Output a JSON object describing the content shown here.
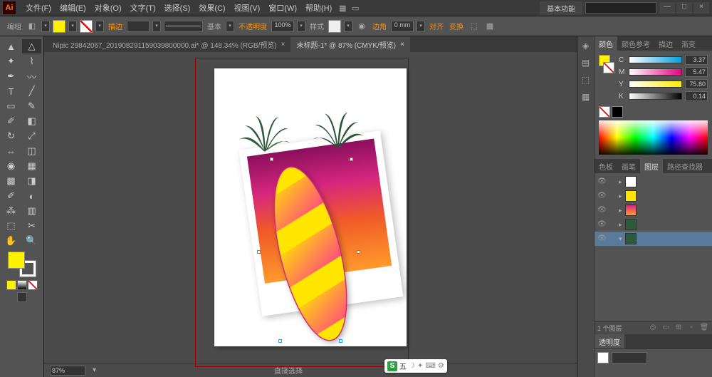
{
  "menu": {
    "file": "文件(F)",
    "edit": "编辑(E)",
    "object": "对象(O)",
    "text": "文字(T)",
    "select": "选择(S)",
    "effect": "效果(C)",
    "view": "视图(V)",
    "window": "窗口(W)",
    "help": "帮助(H)"
  },
  "workspace": "基本功能",
  "options": {
    "group": "编组",
    "stroke": "描边",
    "basic": "基本",
    "opacity_label": "不透明度",
    "opacity": "100%",
    "style": "样式",
    "corner": "边角",
    "corner_val": "0 mm",
    "align": "对齐",
    "transform": "变换"
  },
  "tabs": {
    "t1": "Nipic 29842067_201908291159039800000.ai* @ 148.34% (RGB/预览)",
    "t2": "未标题-1* @ 87% (CMYK/预览)"
  },
  "status": {
    "zoom": "87%",
    "tool": "直接选择"
  },
  "panels": {
    "color_tabs": [
      "颜色",
      "颜色参考",
      "描边",
      "渐变"
    ],
    "cmyk": {
      "c": "3.37",
      "m": "5.47",
      "y": "75.80",
      "k": "0.14"
    },
    "layer_tabs": [
      "色板",
      "画笔",
      "图层",
      "路径查找器"
    ],
    "layers_count": "1 个图层",
    "transparency": "透明度"
  },
  "ime": {
    "letter": "五"
  }
}
